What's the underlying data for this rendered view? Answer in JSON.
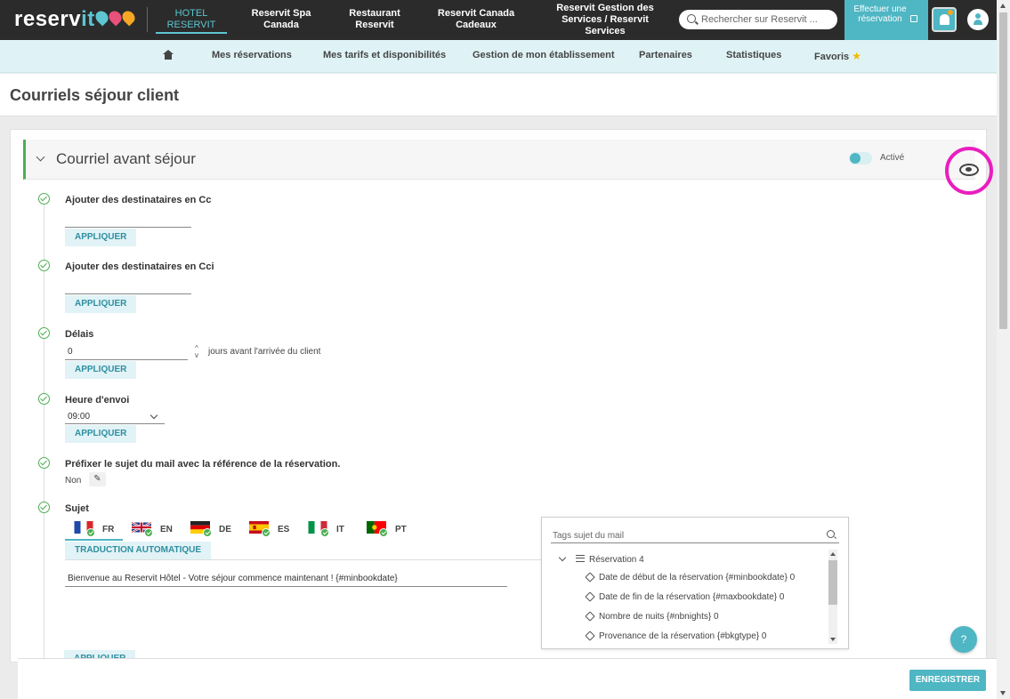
{
  "topbar": {
    "logo_text_a": "reserv",
    "logo_text_b": "it",
    "nav": [
      {
        "label": "HOTEL\nRESERVIT",
        "active": true
      },
      {
        "label": "Reservit Spa\nCanada"
      },
      {
        "label": "Restaurant\nReservit"
      },
      {
        "label": "Reservit Canada\nCadeaux"
      },
      {
        "label": "Reservit Gestion des\nServices / Reservit\nServices"
      }
    ],
    "search_placeholder": "Rechercher sur Reservit ...",
    "book_button": "Effectuer une réservation",
    "colors": {
      "accent": "#4fb6c4",
      "bar": "#2b2b2b",
      "notification": "#f5a623"
    }
  },
  "subnav": {
    "items": [
      "Mes réservations",
      "Mes tarifs et disponibilités",
      "Gestion de mon établissement",
      "Partenaires",
      "Statistiques",
      "Favoris"
    ]
  },
  "page": {
    "title": "Courriels séjour client"
  },
  "section": {
    "title": "Courriel avant séjour",
    "toggle_label": "Activé",
    "highlight_color": "#e91ebf"
  },
  "steps": {
    "cc_label": "Ajouter des destinataires en Cc",
    "cci_label": "Ajouter des destinataires en Cci",
    "delay_label": "Délais",
    "delay_value": "0",
    "delay_suffix": "jours avant l'arrivée du client",
    "send_time_label": "Heure d'envoi",
    "send_time_value": "09:00",
    "prefix_label": "Préfixer le sujet du mail avec la référence de la réservation.",
    "prefix_value": "Non",
    "subject_label": "Sujet",
    "apply_label": "APPLIQUER",
    "translate_label": "TRADUCTION AUTOMATIQUE",
    "subject_value": "Bienvenue au Reservit Hôtel - Votre séjour commence maintenant ! {#minbookdate}"
  },
  "languages": [
    {
      "code": "FR",
      "flag": "fr-flag-icon"
    },
    {
      "code": "EN",
      "flag": "uk-flag-icon"
    },
    {
      "code": "DE",
      "flag": "de-flag-icon"
    },
    {
      "code": "ES",
      "flag": "es-flag-icon"
    },
    {
      "code": "IT",
      "flag": "it-flag-icon"
    },
    {
      "code": "PT",
      "flag": "pt-flag-icon"
    }
  ],
  "tags_panel": {
    "search_placeholder": "Tags sujet du mail",
    "root": "Réservation 4",
    "items": [
      "Date de début de la réservation {#minbookdate} 0",
      "Date de fin de la réservation {#maxbookdate} 0",
      "Nombre de nuits {#nbnights} 0",
      "Provenance de la réservation {#bkgtype} 0"
    ]
  },
  "footer": {
    "save_label": "ENREGISTRER",
    "help_label": "?"
  }
}
